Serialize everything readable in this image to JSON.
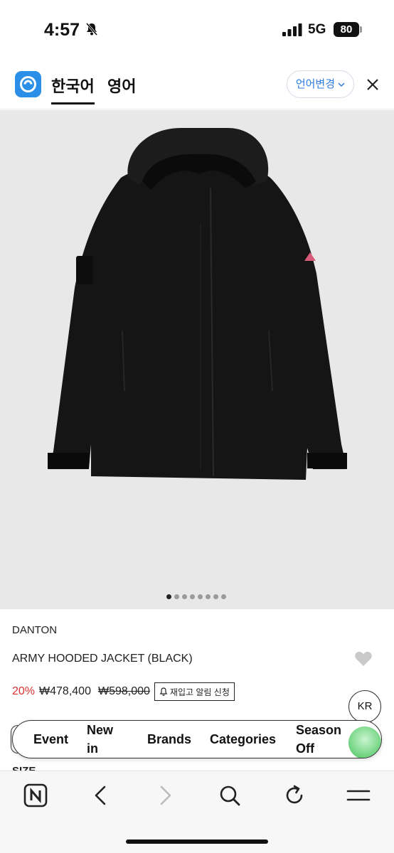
{
  "status_bar": {
    "time": "4:57",
    "network": "5G",
    "battery": "80"
  },
  "translate_bar": {
    "tabs": [
      {
        "label": "한국어",
        "active": true
      },
      {
        "label": "영어",
        "active": false
      }
    ],
    "change_language": "언어변경",
    "icons": [
      "app-logo",
      "chevron-down-icon",
      "close-icon"
    ]
  },
  "gallery": {
    "slide_count": 8,
    "current_slide": 1
  },
  "product": {
    "brand": "DANTON",
    "name": "ARMY HOODED JACKET (BLACK)",
    "discount": "20%",
    "price": "₩478,400",
    "original_price": "₩598,000",
    "restock_label": "재입고 알림 신청",
    "size_heading": "SIZE"
  },
  "currency_button": "KR",
  "category_nav": {
    "items": [
      {
        "label": "Event"
      },
      {
        "label": "New in"
      },
      {
        "label": "Brands"
      },
      {
        "label": "Categories"
      },
      {
        "label": "Season Off"
      }
    ]
  },
  "browser_toolbar": {
    "icons": [
      "naver-n-icon",
      "back-arrow-icon",
      "forward-arrow-icon",
      "search-icon",
      "reload-icon",
      "menu-icon"
    ]
  },
  "colors": {
    "accent_blue": "#2b7be0",
    "discount_red": "#d93030",
    "image_bg": "#e8e8e8",
    "jacket": "#151515"
  }
}
